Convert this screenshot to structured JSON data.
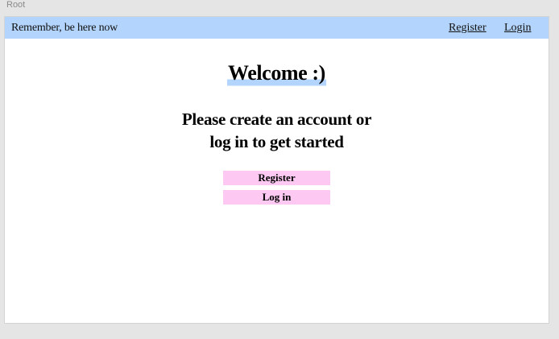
{
  "canvas": {
    "label": "Root"
  },
  "navbar": {
    "brand": "Remember, be here now",
    "links": [
      {
        "label": "Register"
      },
      {
        "label": "Login"
      }
    ],
    "background": "#b3d4fc"
  },
  "main": {
    "heading": "Welcome :)",
    "prompt_line1": "Please create an account or",
    "prompt_line2": "log in to get started",
    "buttons": [
      {
        "label": "Register"
      },
      {
        "label": "Log in"
      }
    ],
    "button_color": "#fdc9f2"
  }
}
